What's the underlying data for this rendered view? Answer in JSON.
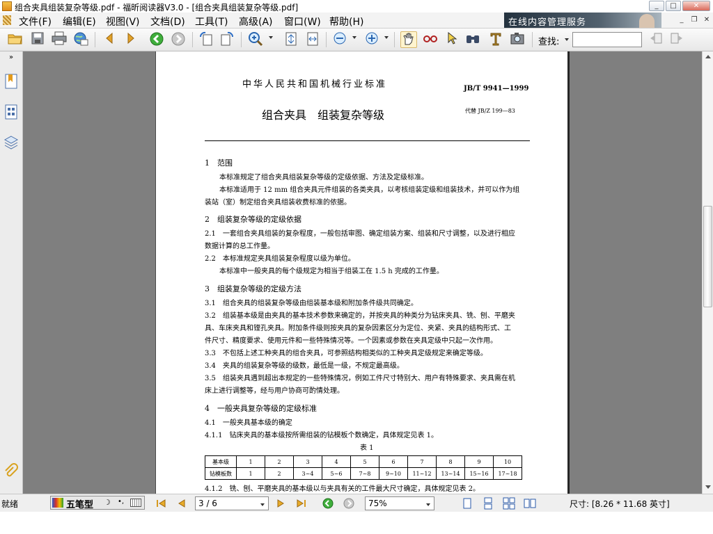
{
  "window": {
    "title": "组合夹具组装复杂等级.pdf - 福昕阅读器V3.0 - [组合夹具组装复杂等级.pdf]",
    "controls": [
      "_",
      "□",
      "✕"
    ]
  },
  "menubar": {
    "items": [
      "文件(F)",
      "编辑(E)",
      "视图(V)",
      "文档(D)",
      "工具(T)",
      "高级(A)",
      "窗口(W)",
      "帮助(H)"
    ],
    "ad_text": "在线内容管理服务",
    "mdi_controls": [
      "_",
      "❐",
      "✕"
    ]
  },
  "toolbar": {
    "find_label": "查找:",
    "find_value": ""
  },
  "document": {
    "header": "中华人民共和国机械行业标准",
    "std_no": "JB/T 9941—1999",
    "title": "组合夹具　组装复杂等级",
    "replaces": "代替 JB/Z 199—83",
    "lines": [
      {
        "t": "1　范围",
        "cls": "h"
      },
      {
        "t": "本标准规定了组合夹具组装复杂等级的定级依据、方法及定级标准。",
        "cls": "p"
      },
      {
        "t": "本标准适用于 12 mm 组合夹具元件组装的各类夹具，以考核组装定级和组装技术，并可以作为组",
        "cls": "p"
      },
      {
        "t": "装站（室）制定组合夹具组装收费标准的依据。",
        "cls": "p"
      },
      {
        "t": "2　组装复杂等级的定级依据",
        "cls": "h"
      },
      {
        "t": "2.1　一套组合夹具组装的复杂程度，一般包括审图、确定组装方案、组装和尺寸调整，以及进行相应",
        "cls": "p"
      },
      {
        "t": "数据计算的总工作量。",
        "cls": "p"
      },
      {
        "t": "2.2　本标准规定夹具组装复杂程度以级为单位。",
        "cls": "p"
      },
      {
        "t": "本标准中一般夹具的每个级规定为相当于组装工在 1.5 h 完成的工作量。",
        "cls": "p"
      },
      {
        "t": "3　组装复杂等级的定级方法",
        "cls": "h"
      },
      {
        "t": "3.1　组合夹具的组装复杂等级由组装基本级和附加条件级共同确定。",
        "cls": "p"
      },
      {
        "t": "3.2　组装基本级是由夹具的基本技术参数来确定的，并按夹具的种类分为钻床夹具、铣、刨、平磨夹",
        "cls": "p"
      },
      {
        "t": "具、车床夹具和镗孔夹具。附加条件级则按夹具的复杂因素区分为定位、夹紧、夹具的结构形式、工",
        "cls": "p"
      },
      {
        "t": "件尺寸、精度要求、使用元件和一些特殊情况等。一个因素或参数在夹具定级中只起一次作用。",
        "cls": "p"
      },
      {
        "t": "3.3　不包括上述工种夹具的组合夹具，可参照结构相类似的工种夹具定级规定来确定等级。",
        "cls": "p"
      },
      {
        "t": "3.4　夹具的组装复杂等级的级数，最低是一级，不规定最高级。",
        "cls": "p"
      },
      {
        "t": "3.5　组装夹具遇到超出本规定的一些特殊情况，例如工件尺寸特别大、用户有特殊要求、夹具需在机",
        "cls": "p"
      },
      {
        "t": "床上进行调整等，经与用户协商可酌情处理。",
        "cls": "p"
      },
      {
        "t": "4　一般夹具复杂等级的定级标准",
        "cls": "h"
      },
      {
        "t": "4.1　一般夹具基本级的确定",
        "cls": "p"
      },
      {
        "t": "4.1.1　钻床夹具的基本级按所需组装的钻模板个数确定，具体规定见表 1。",
        "cls": "p"
      },
      {
        "t": "表 1",
        "cls": "p"
      },
      {
        "t": "4.1.2　铣、刨、平磨夹具的基本级以与夹具有关的工件最大尺寸确定，具体规定见表 2。",
        "cls": "p"
      }
    ],
    "table": {
      "rows": [
        [
          "基本级",
          "1",
          "2",
          "3",
          "4",
          "5",
          "6",
          "7",
          "8",
          "9",
          "10"
        ],
        [
          "钻模板数",
          "1",
          "2",
          "3~4",
          "5~6",
          "7~8",
          "9~10",
          "11~12",
          "13~14",
          "15~16",
          "17~18"
        ]
      ]
    }
  },
  "statusbar": {
    "ready": "就绪",
    "ime_label": "五笔型",
    "page_value": "3 / 6",
    "zoom_value": "75%",
    "size_text": "尺寸: [8.26 * 11.68 英寸]"
  }
}
